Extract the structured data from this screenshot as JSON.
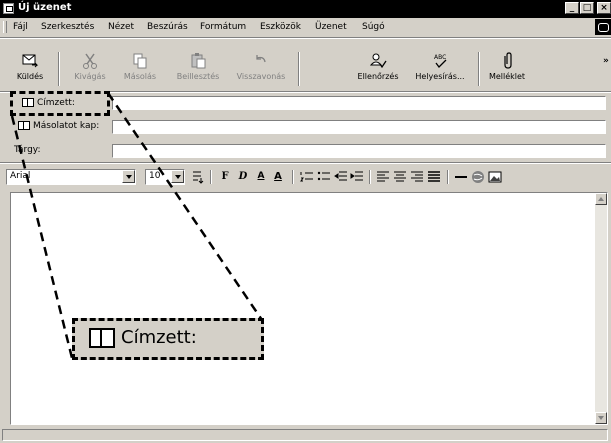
{
  "window": {
    "title": "Új üzenet",
    "controls": [
      "_",
      "□",
      "×"
    ]
  },
  "menubar": {
    "items": [
      {
        "label": "Fájl",
        "name": "menu-fajl"
      },
      {
        "label": "Szerkesztés",
        "name": "menu-szerkesztes"
      },
      {
        "label": "Nézet",
        "name": "menu-nezet"
      },
      {
        "label": "Beszúrás",
        "name": "menu-beszuras"
      },
      {
        "label": "Formátum",
        "name": "menu-formatum"
      },
      {
        "label": "Eszközök",
        "name": "menu-eszkozok"
      },
      {
        "label": "Üzenet",
        "name": "menu-uzenet"
      },
      {
        "label": "Súgó",
        "name": "menu-sugo"
      }
    ]
  },
  "toolbar": {
    "send": "Küldés",
    "cut": "Kivágás",
    "copy": "Másolás",
    "paste": "Beillesztés",
    "undo": "Visszavonás",
    "check": "Ellenőrzés",
    "spelling": "Helyesírás...",
    "attach": "Melléklet",
    "overflow": "»"
  },
  "fields": {
    "to_label": "Címzett:",
    "to_value": "",
    "cc_label": "Másolatot kap:",
    "cc_value": "",
    "subject_label": "Tárgy:",
    "subject_value": ""
  },
  "format": {
    "font": "Arial",
    "size": "10",
    "bold": "F",
    "italic": "D",
    "underline": "A",
    "color": "A"
  },
  "message": {
    "body": ""
  },
  "callout": {
    "label": "Címzett:"
  },
  "status": {
    "text": ""
  },
  "colors": {
    "face": "#d4d0c8",
    "titlebar": "#000000"
  },
  "icons": [
    "send-icon",
    "scissors-icon",
    "copy-icon",
    "paste-icon",
    "undo-icon",
    "check-names-icon",
    "spellcheck-icon",
    "paperclip-icon",
    "address-book-icon"
  ]
}
